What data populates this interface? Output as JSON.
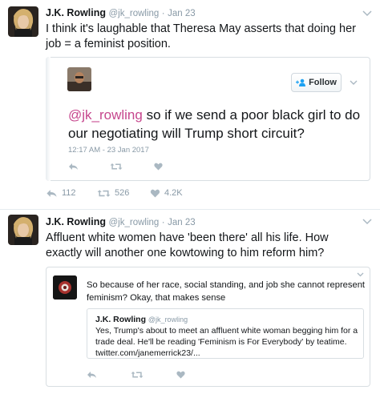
{
  "tweets": [
    {
      "author_name": "J.K. Rowling",
      "handle": "@jk_rowling",
      "separator": "·",
      "date": "Jan 23",
      "text": "I think it's laughable that Theresa May asserts that doing her job = a feminist position.",
      "quoted": {
        "follow_label": "Follow",
        "mention": "@jk_rowling",
        "text": " so if we send a poor black girl to do our negotiating will Trump short circuit?",
        "timestamp": "12:17 AM - 23 Jan 2017"
      },
      "stats": {
        "replies": "112",
        "retweets": "526",
        "likes": "4.2K"
      }
    },
    {
      "author_name": "J.K. Rowling",
      "handle": "@jk_rowling",
      "separator": "·",
      "date": "Jan 23",
      "text": "Affluent white women have 'been there' all his life. How exactly will another one kowtowing to him reform him?",
      "quoted": {
        "text": "So because of her race, social standing, and job she cannot represent feminism? Okay, that makes sense",
        "nested": {
          "author_name": "J.K. Rowling",
          "handle": "@jk_rowling",
          "text": "Yes, Trump's about to meet an affluent white woman begging him for a trade deal. He'll be reading 'Feminism is For Everybody' by teatime. twitter.com/janemerrick23/..."
        }
      }
    }
  ],
  "colors": {
    "text": "#14171a",
    "muted": "#8899a6",
    "mention": "#c6468d",
    "follow_accent": "#1da1f2",
    "border": "#d8dee2"
  },
  "icons": [
    "avatar",
    "chevron-down-icon",
    "reply-icon",
    "retweet-icon",
    "heart-icon",
    "follow-person-plus-icon"
  ]
}
